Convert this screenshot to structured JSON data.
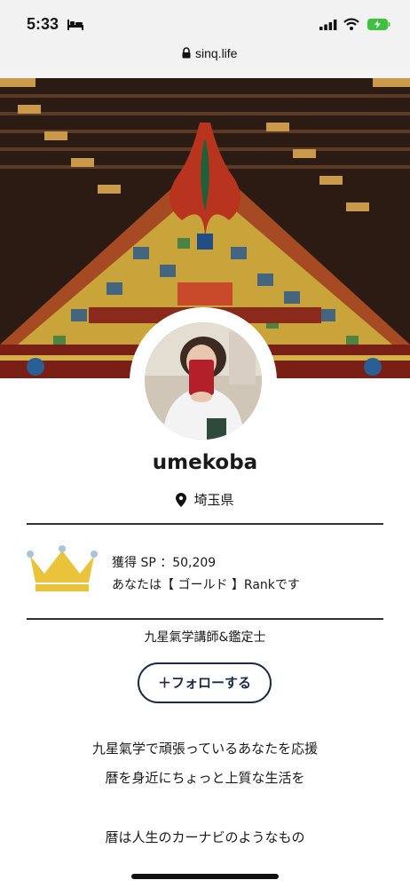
{
  "status": {
    "time": "5:33",
    "url": "sinq.life"
  },
  "profile": {
    "username": "umekoba",
    "location": "埼玉県",
    "sp_line": "獲得 SP ：50,209",
    "rank_line": "あなたは【 ゴールド 】Rankです",
    "title": "九星氣学講師&鑑定士",
    "follow_label": "＋フォローする"
  },
  "bio": {
    "line1": "九星氣学で頑張っているあなたを応援",
    "line2": "暦を身近にちょっと上質な生活を",
    "line3": "暦は人生のカーナビのようなもの"
  },
  "icons": [
    "bed-icon",
    "signal-icon",
    "wifi-icon",
    "battery-icon",
    "lock-icon",
    "pin-icon",
    "crown-icon"
  ],
  "colors": {
    "accent": "#1d2a44",
    "crown": "#e9c33a",
    "battery": "#3fc03f"
  }
}
